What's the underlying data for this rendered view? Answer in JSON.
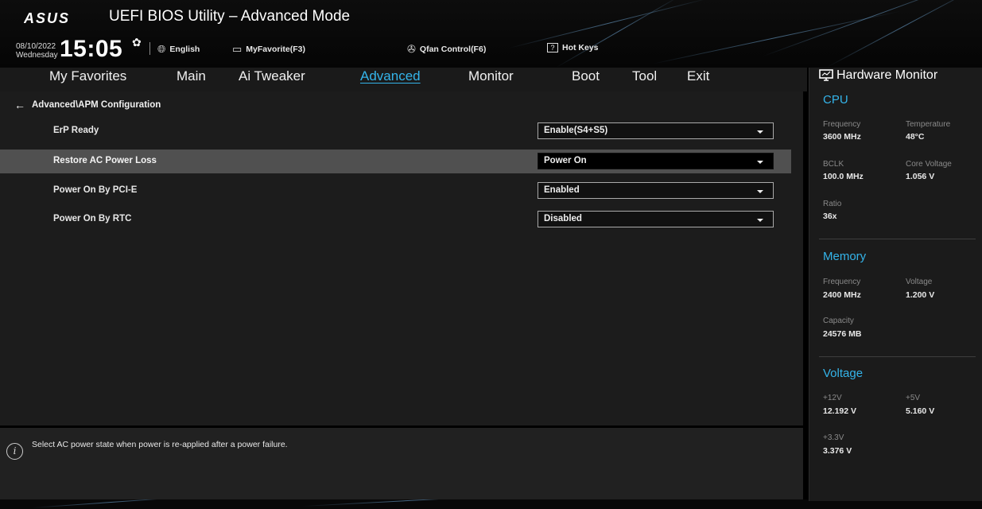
{
  "header": {
    "logo_text": "ASUS",
    "title": "UEFI BIOS Utility – Advanced Mode",
    "date": "08/10/2022",
    "weekday": "Wednesday",
    "time": "15:05",
    "language": "English",
    "favorite": "MyFavorite(F3)",
    "qfan": "Qfan Control(F6)",
    "hotkeys": "Hot Keys",
    "gear_icon": "gear-icon",
    "globe_icon": "globe-icon",
    "favorite_icon": "monitor-icon",
    "fan_icon": "fan-icon",
    "hotkey_icon": "question-key-icon"
  },
  "menu": {
    "items": [
      "My Favorites",
      "Main",
      "Ai Tweaker",
      "Advanced",
      "Monitor",
      "Boot",
      "Tool",
      "Exit"
    ],
    "active": "Advanced"
  },
  "breadcrumb": "Advanced\\APM Configuration",
  "settings": [
    {
      "label": "ErP Ready",
      "value": "Enable(S4+S5)",
      "selected": false
    },
    {
      "label": "Restore AC Power Loss",
      "value": "Power On",
      "selected": true
    },
    {
      "label": "Power On By PCI-E",
      "value": "Enabled",
      "selected": false
    },
    {
      "label": "Power On By RTC",
      "value": "Disabled",
      "selected": false
    }
  ],
  "help_text": "Select AC power state when power is re-applied after a power failure.",
  "hardware_monitor": {
    "title": "Hardware Monitor",
    "cpu": {
      "heading": "CPU",
      "frequency_label": "Frequency",
      "frequency": "3600 MHz",
      "temperature_label": "Temperature",
      "temperature": "48°C",
      "bclk_label": "BCLK",
      "bclk": "100.0 MHz",
      "core_voltage_label": "Core Voltage",
      "core_voltage": "1.056 V",
      "ratio_label": "Ratio",
      "ratio": "36x"
    },
    "memory": {
      "heading": "Memory",
      "frequency_label": "Frequency",
      "frequency": "2400 MHz",
      "voltage_label": "Voltage",
      "voltage": "1.200 V",
      "capacity_label": "Capacity",
      "capacity": "24576 MB"
    },
    "voltage": {
      "heading": "Voltage",
      "v12_label": "+12V",
      "v12": "12.192 V",
      "v5_label": "+5V",
      "v5": "5.160 V",
      "v33_label": "+3.3V",
      "v33": "3.376 V"
    }
  },
  "colors": {
    "accent": "#34b4ea",
    "selected_row": "#505050",
    "panel": "#1c1c1c"
  }
}
